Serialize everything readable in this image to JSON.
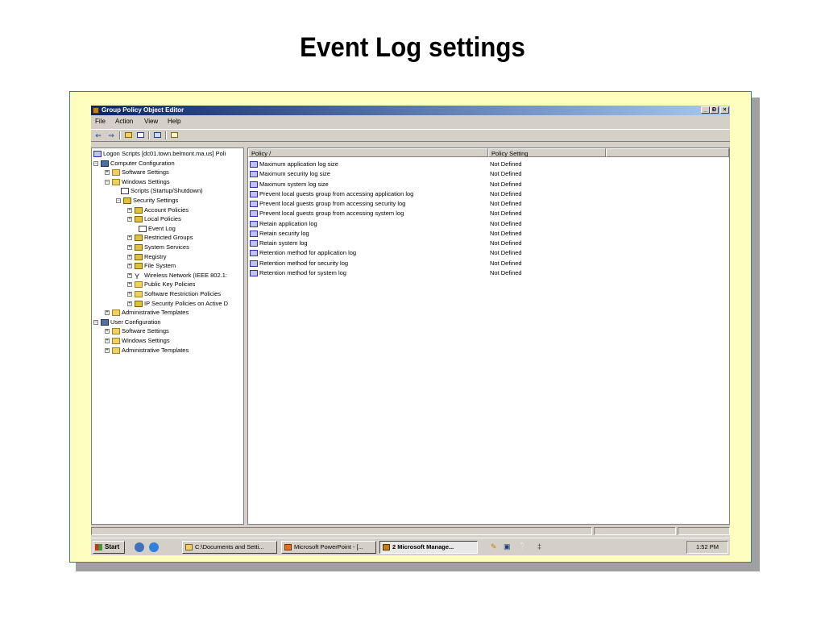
{
  "slide": {
    "title": "Event Log settings"
  },
  "window": {
    "title": "Group Policy Object Editor",
    "controls": {
      "minimize": "_",
      "restore": "Ɖ",
      "close": "×"
    }
  },
  "menu": [
    "File",
    "Action",
    "View",
    "Help"
  ],
  "toolbar": {
    "back": "⇐",
    "forward": "⇒"
  },
  "tree": [
    {
      "label": "Logon Scripts [dc01.town.belmont.ma.us] Poli",
      "icon": "policy-icon",
      "expander": ""
    },
    {
      "label": "Computer Configuration",
      "icon": "pc-icon",
      "expander": "−"
    },
    {
      "label": "Software Settings",
      "icon": "folder-icon",
      "expander": "+"
    },
    {
      "label": "Windows Settings",
      "icon": "folder-icon",
      "expander": "−"
    },
    {
      "label": "Scripts (Startup/Shutdown)",
      "icon": "doc-icon",
      "expander": ""
    },
    {
      "label": "Security Settings",
      "icon": "sec-icon",
      "expander": "−"
    },
    {
      "label": "Account Policies",
      "icon": "sec-icon",
      "expander": "+"
    },
    {
      "label": "Local Policies",
      "icon": "sec-icon",
      "expander": "+"
    },
    {
      "label": "Event Log",
      "icon": "doc-icon",
      "expander": ""
    },
    {
      "label": "Restricted Groups",
      "icon": "sec-icon",
      "expander": "+"
    },
    {
      "label": "System Services",
      "icon": "sec-icon",
      "expander": "+"
    },
    {
      "label": "Registry",
      "icon": "sec-icon",
      "expander": "+"
    },
    {
      "label": "File System",
      "icon": "sec-icon",
      "expander": "+"
    },
    {
      "label": "Wireless Network (IEEE 802.1:",
      "icon": "antenna-icon",
      "expander": "+"
    },
    {
      "label": "Public Key Policies",
      "icon": "folder-icon",
      "expander": "+"
    },
    {
      "label": "Software Restriction Policies",
      "icon": "folder-icon",
      "expander": "+"
    },
    {
      "label": "IP Security Policies on Active D",
      "icon": "sec-icon",
      "expander": "+"
    },
    {
      "label": "Administrative Templates",
      "icon": "folder-icon",
      "expander": "+"
    },
    {
      "label": "User Configuration",
      "icon": "pc-icon",
      "expander": "−"
    },
    {
      "label": "Software Settings",
      "icon": "folder-icon",
      "expander": "+"
    },
    {
      "label": "Windows Settings",
      "icon": "folder-icon",
      "expander": "+"
    },
    {
      "label": "Administrative Templates",
      "icon": "folder-icon",
      "expander": "+"
    }
  ],
  "list": {
    "columns": [
      "Policy  /",
      "Policy Setting"
    ],
    "rows": [
      {
        "policy": "Maximum application log size",
        "setting": "Not Defined"
      },
      {
        "policy": "Maximum security log size",
        "setting": "Not Defined"
      },
      {
        "policy": "Maximum system log size",
        "setting": "Not Defined"
      },
      {
        "policy": "Prevent local guests group from accessing application log",
        "setting": "Not Defined"
      },
      {
        "policy": "Prevent local guests group from accessing security log",
        "setting": "Not Defined"
      },
      {
        "policy": "Prevent local guests group from accessing system log",
        "setting": "Not Defined"
      },
      {
        "policy": "Retain application log",
        "setting": "Not Defined"
      },
      {
        "policy": "Retain security log",
        "setting": "Not Defined"
      },
      {
        "policy": "Retain system log",
        "setting": "Not Defined"
      },
      {
        "policy": "Retention method for application log",
        "setting": "Not Defined"
      },
      {
        "policy": "Retention method for security log",
        "setting": "Not Defined"
      },
      {
        "policy": "Retention method for system log",
        "setting": "Not Defined"
      }
    ]
  },
  "taskbar": {
    "start": "Start",
    "tasks": [
      {
        "label": "C:\\Documents and Setti...",
        "icon": "folder-icon"
      },
      {
        "label": "Microsoft PowerPoint - [...",
        "icon": "powerpoint-icon"
      },
      {
        "label": "2 Microsoft Manage...",
        "icon": "mmc-icon",
        "active": true
      }
    ],
    "clock": "1:52 PM"
  }
}
